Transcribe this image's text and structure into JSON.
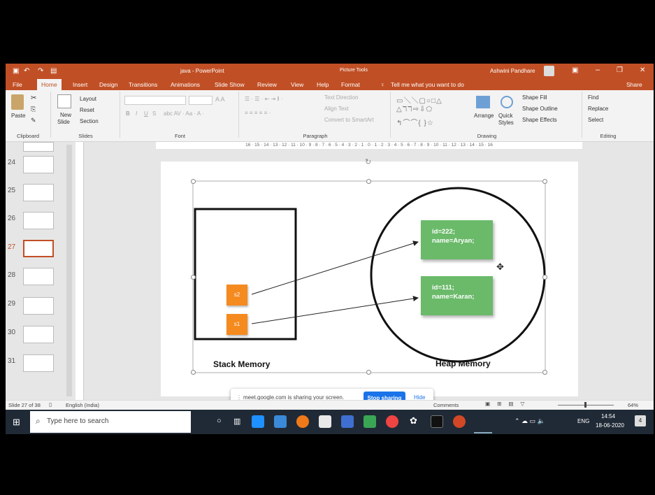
{
  "titlebar": {
    "title": "java - PowerPoint",
    "context": "Picture Tools",
    "user": "Ashwini Pandhare"
  },
  "tabs": [
    "File",
    "Home",
    "Insert",
    "Design",
    "Transitions",
    "Animations",
    "Slide Show",
    "Review",
    "View",
    "Help",
    "Format"
  ],
  "tell_me": "Tell me what you want to do",
  "share": "Share",
  "ribbon": {
    "clipboard": {
      "paste": "Paste",
      "label": "Clipboard"
    },
    "slides": {
      "new_slide": "New",
      "new_slide2": "Slide",
      "layout": "Layout",
      "reset": "Reset",
      "section": "Section",
      "label": "Slides"
    },
    "font": {
      "bold": "B",
      "italic": "I",
      "underline": "U",
      "shadow": "S",
      "label": "Font"
    },
    "paragraph": {
      "text_direction": "Text Direction",
      "align_text": "Align Text",
      "smartart": "Convert to SmartArt",
      "label": "Paragraph"
    },
    "drawing": {
      "arrange": "Arrange",
      "quick1": "Quick",
      "quick2": "Styles",
      "fill": "Shape Fill",
      "outline": "Shape Outline",
      "effects": "Shape Effects",
      "label": "Drawing"
    },
    "editing": {
      "find": "Find",
      "replace": "Replace",
      "select": "Select",
      "label": "Editing"
    }
  },
  "thumbnails": [
    {
      "num": "24"
    },
    {
      "num": "25"
    },
    {
      "num": "26"
    },
    {
      "num": "27"
    },
    {
      "num": "28"
    },
    {
      "num": "29"
    },
    {
      "num": "30"
    },
    {
      "num": "31"
    }
  ],
  "ruler_text": "16 · 15 · 14 · 13 · 12 · 11 · 10 · 9 · 8 · 7 · 6 · 5 · 4 · 3 · 2 · 1 · 0 · 1 · 2 · 3 · 4 · 5 · 6 · 7 · 8 · 9 · 10 · 11 · 12 · 13 · 14 · 15 · 16",
  "slide": {
    "stack_label": "Stack Memory",
    "heap_label": "Heap Memory",
    "s2": "s2",
    "s1": "s1",
    "obj1_line1": "id=222;",
    "obj1_line2": "name=Aryan;",
    "obj2_line1": "id=111;",
    "obj2_line2": "name=Karan;"
  },
  "sharebar": {
    "message": "meet.google.com is sharing your screen.",
    "stop": "Stop sharing",
    "hide": "Hide"
  },
  "status": {
    "slide": "Slide 27 of 38",
    "lang": "English (India)",
    "comments": "Comments",
    "zoom": "64%"
  },
  "taskbar": {
    "search": "Type here to search",
    "lang": "ENG",
    "time": "14:54",
    "date": "18-06-2020",
    "notif": "4"
  },
  "colors": {
    "accent": "#c14f25",
    "green_box": "#6aba6a",
    "orange_box": "#f58a1f",
    "taskbar": "#202a36"
  }
}
